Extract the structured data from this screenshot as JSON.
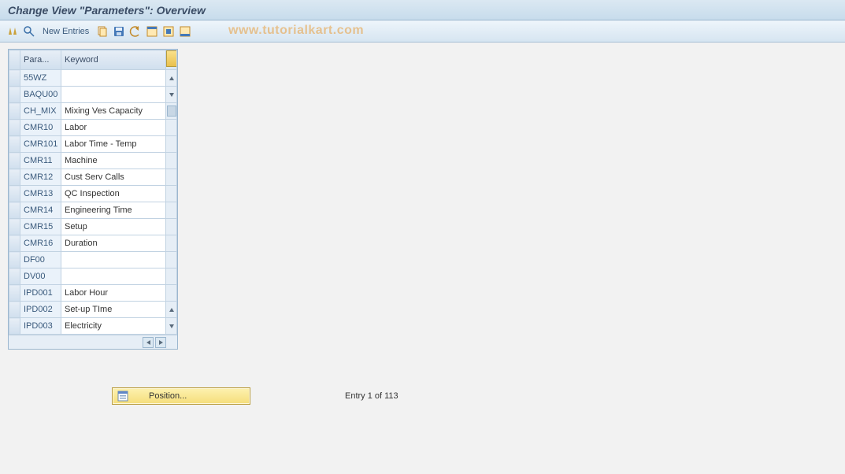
{
  "title": "Change View \"Parameters\": Overview",
  "watermark": "www.tutorialkart.com",
  "toolbar": {
    "new_entries": "New Entries"
  },
  "table": {
    "headers": {
      "param": "Para...",
      "keyword": "Keyword"
    },
    "rows": [
      {
        "param": "55WZ",
        "keyword": ""
      },
      {
        "param": "BAQU00",
        "keyword": ""
      },
      {
        "param": "CH_MIX",
        "keyword": "Mixing Ves Capacity"
      },
      {
        "param": "CMR10",
        "keyword": "Labor"
      },
      {
        "param": "CMR101",
        "keyword": "Labor Time - Temp"
      },
      {
        "param": "CMR11",
        "keyword": "Machine"
      },
      {
        "param": "CMR12",
        "keyword": "Cust Serv Calls"
      },
      {
        "param": "CMR13",
        "keyword": "QC Inspection"
      },
      {
        "param": "CMR14",
        "keyword": "Engineering Time"
      },
      {
        "param": "CMR15",
        "keyword": "Setup"
      },
      {
        "param": "CMR16",
        "keyword": "Duration"
      },
      {
        "param": "DF00",
        "keyword": ""
      },
      {
        "param": "DV00",
        "keyword": ""
      },
      {
        "param": "IPD001",
        "keyword": "Labor Hour"
      },
      {
        "param": "IPD002",
        "keyword": "Set-up TIme"
      },
      {
        "param": "IPD003",
        "keyword": "Electricity"
      }
    ]
  },
  "position_button": "Position...",
  "status": "Entry 1 of 113"
}
